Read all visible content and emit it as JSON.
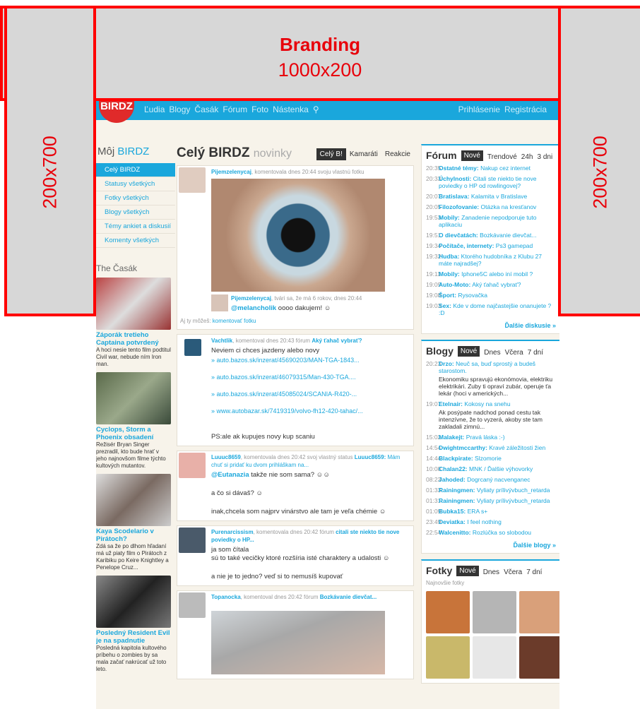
{
  "ads": {
    "top_title": "Branding",
    "top_size": "1000x200",
    "left_size": "200x700",
    "right_size": "200x700"
  },
  "nav": {
    "logo": "BIRDZ",
    "links": [
      "Ľudia",
      "Blogy",
      "Časák",
      "Fórum",
      "Foto",
      "Nástenka"
    ],
    "login": "Prihlásenie",
    "register": "Registrácia"
  },
  "left": {
    "title_prefix": "Môj ",
    "title_brand": "BIRDZ",
    "menu": [
      "Celý BIRDZ",
      "Statusy všetkých",
      "Fotky všetkých",
      "Blogy všetkých",
      "Témy ankiet a diskusií",
      "Komenty všetkých"
    ],
    "casak_title": "The Časák",
    "articles": [
      {
        "title": "Záporák tretieho Captaina potvrdený",
        "text": "A hoci nesie tento film podtitul Civil war, nebude ním Iron man.",
        "color": "#c85a4a"
      },
      {
        "title": "Cyclops, Storm a Phoenix obsadení",
        "text": "Režisér Bryan Singer prezradil, kto bude hrať v jeho najnovšom filme týchto kultových mutantov.",
        "color": "#7a8a6a"
      },
      {
        "title": "Kaya Scodelario v Pirátoch?",
        "text": "Zdá sa že po dlhom hľadaní má už piaty film o Pirátoch z Karibiku po Keire Knightley a Penelope Cruz...",
        "color": "#7a6a62"
      },
      {
        "title": "Posledný Resident Evil je na spadnutie",
        "text": "Posledná kapitola kultového príbehu o zombies by sa mala začať nakrúcať už toto leto.",
        "color": "#4a4a4a"
      }
    ]
  },
  "feed": {
    "title": "Celý BIRDZ",
    "subtitle": "novinky",
    "tabs": [
      "Celý B!",
      "Kamaráti",
      "Reakcie"
    ],
    "posts": [
      {
        "user": "Pijemzelenycaj",
        "meta": ", komentovala dnes 20:44 svoju vlastnú fotku",
        "reply_user": "Pijemzelenycaj",
        "reply_meta": ", tvári sa, že má 6 rokov, dnes 20:44",
        "reply_mention": "@melancholik",
        "reply_text": " oooo dakujem!",
        "cta_prefix": "Aj ty môžeš: ",
        "cta": "komentovať fotku"
      },
      {
        "user": "Vachtlik",
        "meta": ", komentoval dnes 20:43 fórum ",
        "topic": "Aký ťahač vybrať?",
        "text": "Neviem ci chces jazdeny alebo novy",
        "links": [
          "» auto.bazos.sk/inzerat/45690203/MAN-TGA-1843...",
          "» auto.bazos.sk/inzerat/46079315/Man-430-TGA....",
          "» auto.bazos.sk/inzerat/45085024/SCANIA-R420-...",
          "» www.autobazar.sk/7419319/volvo-fh12-420-tahac/..."
        ],
        "tail": "PS:ale ak kupujes novy kup scaniu"
      },
      {
        "user": "Luuuc8659",
        "meta": ", komentovala dnes 20:42 svoj vlastný status ",
        "topic": "Luuuc8659:",
        "topic_text": " Mám chuť si pridať ku dvom prihláškam na...",
        "mention": "@Eutanazia",
        "line1": " takže nie som sama?",
        "line2": "a čo si dávaš?",
        "line3": "inak,chcela som najprv vinárstvo ale tam je veľa chémie"
      },
      {
        "user": "Purenarcissism",
        "meta": ", komentovala dnes 20:42 fórum ",
        "topic": "citali ste niekto tie nove poviedky o HP...",
        "line1": "ja som čítala",
        "line2": "sú to také vecičky ktoré rozšíria isté charaktery a udalosti",
        "line3": "a nie je to jedno? veď si to nemusíš kupovať"
      },
      {
        "user": "Topanocka",
        "meta": ", komentoval dnes 20:42 fórum ",
        "topic": "Bozkávanie dievčat..."
      }
    ]
  },
  "forum": {
    "title": "Fórum",
    "tabs": [
      "Nové",
      "Trendové",
      "24h",
      "3 dni"
    ],
    "items": [
      {
        "t": "20:35",
        "c": "Ostatné témy:",
        "x": "Nakup cez internet"
      },
      {
        "t": "20:33",
        "c": "Úchylnosti:",
        "x": "Citali ste niekto tie nove poviedky o HP od rowlingovej?"
      },
      {
        "t": "20:07",
        "c": "Bratislava:",
        "x": "Kalamita v Bratislave"
      },
      {
        "t": "20:05",
        "c": "Filozofovanie:",
        "x": "Otázka na kresťanov"
      },
      {
        "t": "19:53",
        "c": "Mobily:",
        "x": "Zanadenie nepodporuje tuto aplikaciu"
      },
      {
        "t": "19:51",
        "c": "O dievčatách:",
        "x": "Bozkávanie dievčat..."
      },
      {
        "t": "19:34",
        "c": "Počítače, internety:",
        "x": "Ps3 gamepad"
      },
      {
        "t": "19:32",
        "c": "Hudba:",
        "x": "Ktorého hudobníka z Klubu 27 máte najradšej?"
      },
      {
        "t": "19:11",
        "c": "Mobily:",
        "x": "Iphone5C alebo iní mobil ?"
      },
      {
        "t": "19:09",
        "c": "Auto-Moto:",
        "x": "Aký ťahač vybrať?"
      },
      {
        "t": "19:08",
        "c": "Šport:",
        "x": "Rysovačka"
      },
      {
        "t": "19:03",
        "c": "Sex:",
        "x": "Kde v dome najčastejšie onanujete ? :D"
      }
    ],
    "more": "Ďalšie diskusie »"
  },
  "blogs": {
    "title": "Blogy",
    "tabs": [
      "Nové",
      "Dnes",
      "Včera",
      "7 dní"
    ],
    "items": [
      {
        "t": "20:23",
        "c": "Drzo:",
        "x": "Neuč sa, buď sprostý a budeš starostom.",
        "d": "Ekonomiku spravujú ekonómovia, elektriku elektrikári. Zuby ti opraví zubár, operuje ťa lekár (hoci v amerických..."
      },
      {
        "t": "19:07",
        "c": "Etelnair:",
        "x": "Kokosy na snehu",
        "d": "Ak posýpate nadchod ponad cestu tak intenzívne, že to vyzerá, akoby ste tam zakladali zimnú..."
      },
      {
        "t": "15:02",
        "c": "Malakejt:",
        "x": "Pravá láska :-)"
      },
      {
        "t": "14:54",
        "c": "Dwightmccarthy:",
        "x": "Kravé záležitosti žien"
      },
      {
        "t": "14:44",
        "c": "Blackpirate:",
        "x": "Slzomorie"
      },
      {
        "t": "10:08",
        "c": "Chalan22:",
        "x": "MNK / Ďalšie výhovorky"
      },
      {
        "t": "08:23",
        "c": "Jahoded:",
        "x": "Dogrcaný nacvenganec"
      },
      {
        "t": "01:33",
        "c": "Rainingmen:",
        "x": "Vyliaty prílivývbuch_retarda"
      },
      {
        "t": "01:31",
        "c": "Rainingmen:",
        "x": "Vyliaty prílivývbuch_retarda"
      },
      {
        "t": "01:09",
        "c": "Bubka15:",
        "x": "ERA s+"
      },
      {
        "t": "23:49",
        "c": "Deviatka:",
        "x": "I feel nothing"
      },
      {
        "t": "22:54",
        "c": "Walcenitto:",
        "x": "Rozlúčka so slobodou"
      }
    ],
    "more": "Ďalšie blogy »"
  },
  "photos": {
    "title": "Fotky",
    "tabs": [
      "Nové",
      "Dnes",
      "Včera",
      "7 dní"
    ],
    "subtitle": "Najnovšie fotky",
    "colors": [
      "#c8743a",
      "#b5b5b5",
      "#d9a07a",
      "#c9b86a",
      "#e7e7e7",
      "#6b3b2a"
    ]
  },
  "colors": {
    "accent": "#1aa7dc",
    "ad_red": "#e8000a",
    "ad_gray": "#d7d7d7"
  }
}
